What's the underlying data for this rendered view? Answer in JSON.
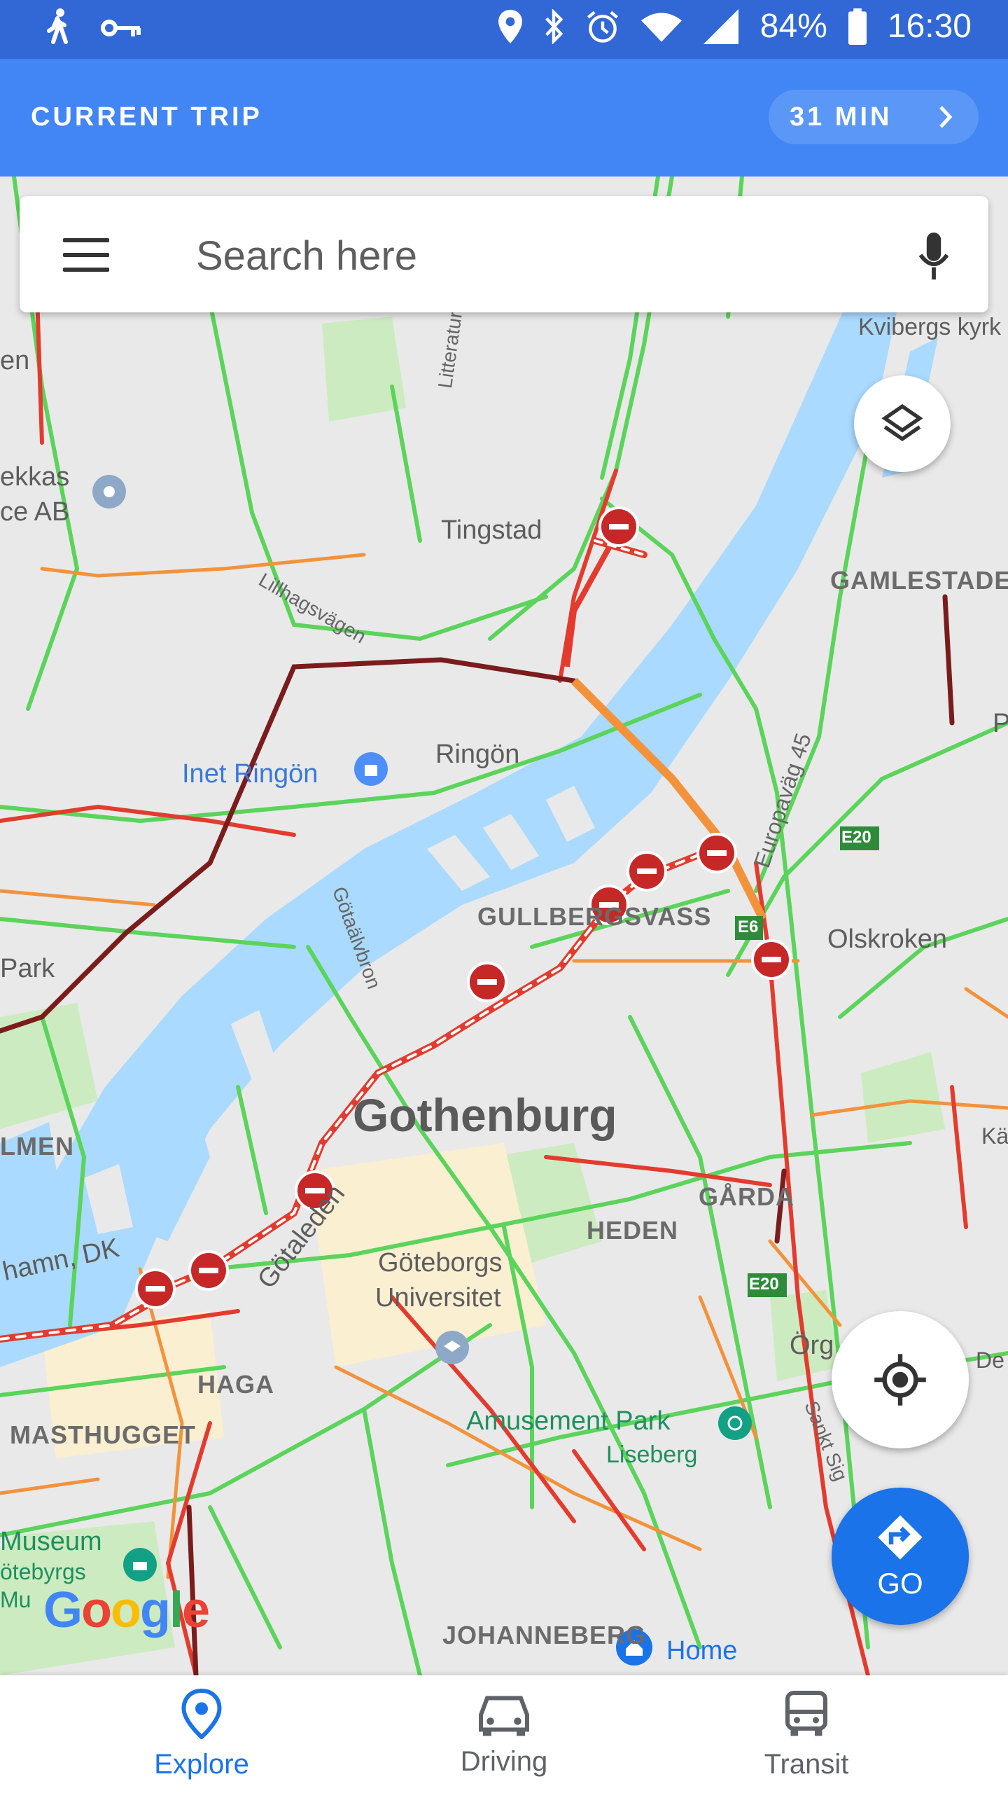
{
  "status_bar": {
    "icons_left": [
      "walk-icon",
      "vpn-key-icon"
    ],
    "icons_right": [
      "location-icon",
      "bluetooth-icon",
      "alarm-icon",
      "wifi-icon",
      "cellular-icon",
      "battery-icon"
    ],
    "battery": "84%",
    "time": "16:30"
  },
  "trip_banner": {
    "title": "CURRENT TRIP",
    "duration": "31 MIN",
    "icon": "chevron-right-icon"
  },
  "search": {
    "placeholder": "Search here",
    "menu_icon": "hamburger-menu-icon",
    "mic_icon": "microphone-icon"
  },
  "map": {
    "labels": {
      "tingstad": "Tingstad",
      "litteraturgatan": "Litteraturgatan",
      "lillhagsvagen": "Lillhagsvägen",
      "ringon": "Ringön",
      "inet_ringon": "Inet Ringön",
      "gotaalvbron": "Götaälvbron",
      "gullbergsvass": "GULLBERGSVASS",
      "gamlestaden": "GAMLESTADE",
      "europavag": "Europaväg 45",
      "olskroken": "Olskroken",
      "gothenburg": "Gothenburg",
      "garda": "GÅRDA",
      "heden": "HEDEN",
      "goteborgs_universitet_1": "Göteborgs",
      "goteborgs_universitet_2": "Universitet",
      "haga": "HAGA",
      "masthugget": "MASTHUGGET",
      "almen": "LMEN",
      "amusement_park": "Amusement Park",
      "liseberg": "Liseberg",
      "johanneberg": "JOHANNEBERG",
      "home": "Home",
      "orgryte": "Örg",
      "sankt_sig": "Sankt Sig",
      "kvibergs": "Kvibergs kyrk",
      "park": "Park",
      "ekkas_1": "ekkas",
      "ekkas_2": "ce AB",
      "en": "en",
      "hamn": "hamn, DK",
      "museum": "Museum",
      "goteborgs_mu": "ötebyrgs",
      "mu": "Mu",
      "gotaleden": "Götaleden",
      "e6": "E6",
      "e20_a": "E20",
      "e20_b": "E20",
      "ka": "Kä",
      "de": "De",
      "p": "P"
    },
    "layers_icon": "layers-icon",
    "locate_icon": "my-location-icon",
    "go_label": "GO",
    "go_icon": "directions-icon",
    "brand": "Google",
    "colors": {
      "water": "#aadaff",
      "land": "#e9e9e9",
      "park": "#cdebc0",
      "traffic_green": "#5ad45a",
      "traffic_orange": "#f2933c",
      "traffic_red": "#e33b2e",
      "traffic_darkred": "#7a1c1c",
      "closure": "#d32f2f"
    }
  },
  "bottom_nav": {
    "items": [
      {
        "label": "Explore",
        "icon": "location-pin-icon",
        "active": true
      },
      {
        "label": "Driving",
        "icon": "car-icon",
        "active": false
      },
      {
        "label": "Transit",
        "icon": "bus-icon",
        "active": false
      }
    ]
  }
}
